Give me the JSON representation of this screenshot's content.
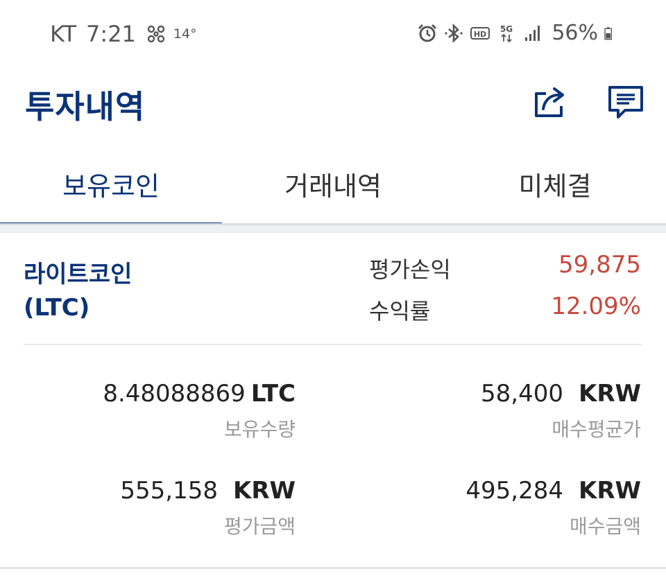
{
  "status_bar": {
    "carrier": "KT",
    "time": "7:21",
    "temperature": "14°",
    "battery_percent": "56%",
    "icons": [
      "fan-icon",
      "alarm-icon",
      "bluetooth-icon",
      "hd-icon",
      "5g-icon",
      "signal-icon",
      "battery-icon"
    ]
  },
  "header": {
    "title": "투자내역",
    "actions": [
      "share-icon",
      "chat-icon"
    ]
  },
  "tabs": [
    {
      "label": "보유코인",
      "active": true
    },
    {
      "label": "거래내역",
      "active": false
    },
    {
      "label": "미체결",
      "active": false
    }
  ],
  "holding": {
    "coin_name": "라이트코인",
    "coin_symbol": "(LTC)",
    "profit_label": "평가손익",
    "profit_value": "59,875",
    "return_label": "수익률",
    "return_value": "12.09%",
    "quantity_value": "8.48088869",
    "quantity_unit": "LTC",
    "quantity_label": "보유수량",
    "avg_price_value": "58,400",
    "avg_price_unit": "KRW",
    "avg_price_label": "매수평균가",
    "eval_amount_value": "555,158",
    "eval_amount_unit": "KRW",
    "eval_amount_label": "평가금액",
    "buy_amount_value": "495,284",
    "buy_amount_unit": "KRW",
    "buy_amount_label": "매수금액"
  },
  "colors": {
    "brand_navy": "#0b3478",
    "profit_red": "#c8473b"
  }
}
